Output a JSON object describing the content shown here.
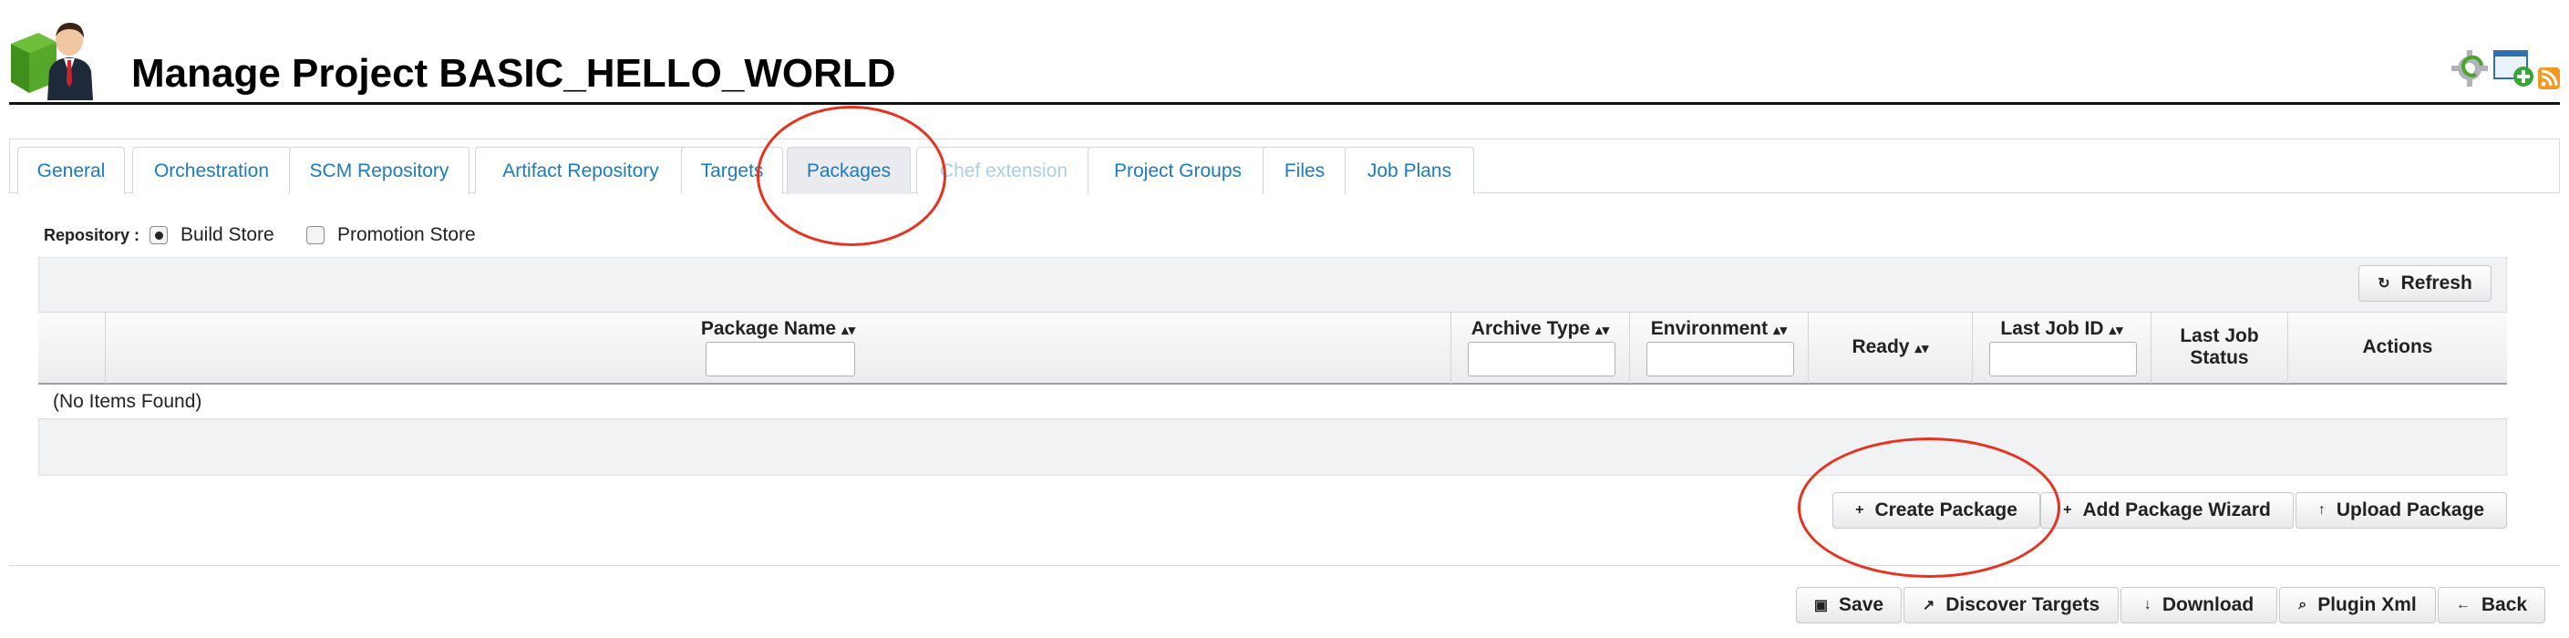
{
  "header": {
    "title": "Manage Project BASIC_HELLO_WORLD",
    "avatar_icon": "user-with-cube-icon",
    "right_icons": [
      "gear-refresh-icon",
      "add-window-icon",
      "rss-icon"
    ]
  },
  "tabs": [
    {
      "label": "General",
      "state": "normal"
    },
    {
      "label": "Orchestration",
      "state": "normal"
    },
    {
      "label": "SCM Repository",
      "state": "normal"
    },
    {
      "label": "Artifact Repository",
      "state": "normal"
    },
    {
      "label": "Targets",
      "state": "normal"
    },
    {
      "label": "Packages",
      "state": "active"
    },
    {
      "label": "Chef extension",
      "state": "disabled"
    },
    {
      "label": "Project Groups",
      "state": "normal"
    },
    {
      "label": "Files",
      "state": "normal"
    },
    {
      "label": "Job Plans",
      "state": "normal"
    }
  ],
  "repository": {
    "label": "Repository :",
    "options": [
      {
        "label": "Build Store",
        "selected": true
      },
      {
        "label": "Promotion Store",
        "selected": false
      }
    ]
  },
  "grid": {
    "refresh_label": "Refresh",
    "columns": [
      {
        "label": "",
        "sortable": false
      },
      {
        "label": "Package Name",
        "sortable": true,
        "filter": true
      },
      {
        "label": "Archive Type",
        "sortable": true,
        "filter": true
      },
      {
        "label": "Environment",
        "sortable": true,
        "filter": true
      },
      {
        "label": "Ready",
        "sortable": true,
        "filter": false
      },
      {
        "label": "Last Job ID",
        "sortable": true,
        "filter": true
      },
      {
        "label": "Last Job Status",
        "sortable": false,
        "filter": false
      },
      {
        "label": "Actions",
        "sortable": false,
        "filter": false
      }
    ],
    "empty_text": "(No Items Found)"
  },
  "package_actions": {
    "create": "Create Package",
    "wizard": "Add Package Wizard",
    "upload": "Upload Package"
  },
  "footer_actions": {
    "save": "Save",
    "discover": "Discover Targets",
    "download": "Download",
    "plugin_xml": "Plugin Xml",
    "back": "Back"
  },
  "colors": {
    "link_blue": "#1a7bbf",
    "annotation_red": "#e8321f"
  }
}
